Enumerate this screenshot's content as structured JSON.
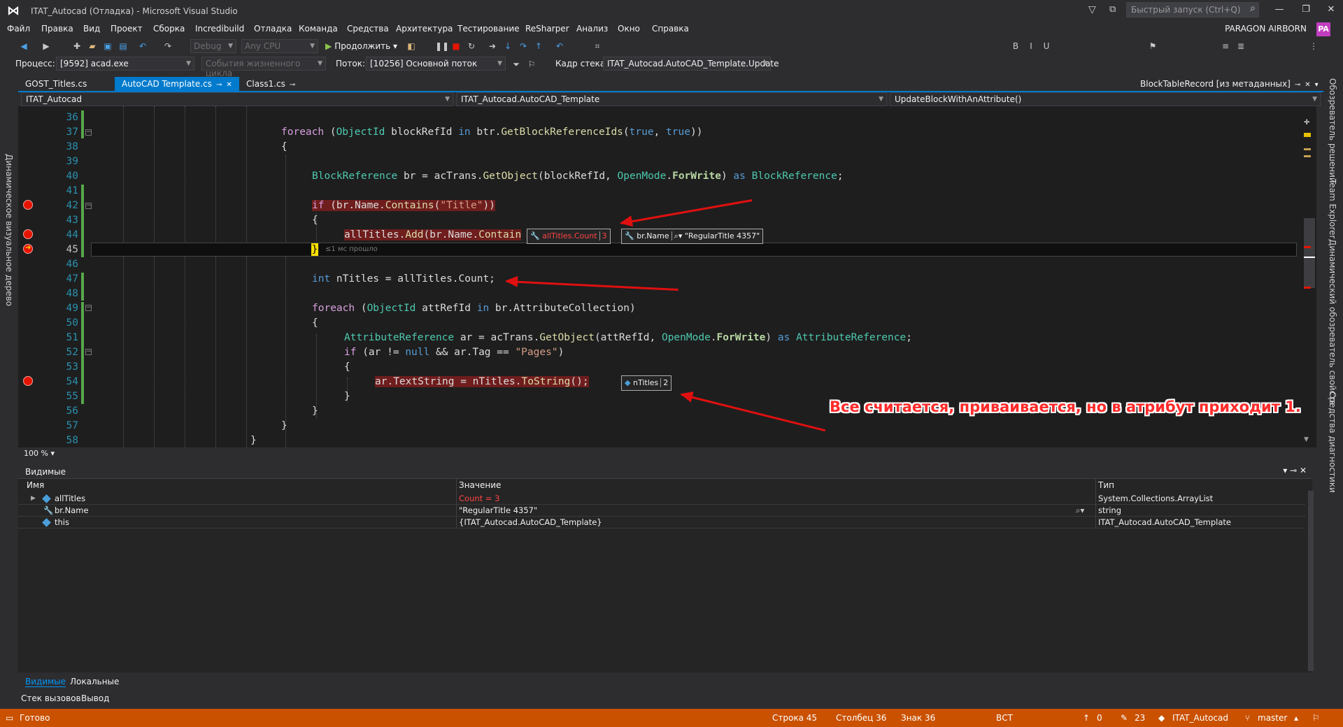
{
  "window": {
    "title": "ITAT_Autocad (Отладка) - Microsoft Visual Studio",
    "quick_launch_placeholder": "Быстрый запуск (Ctrl+Q)",
    "user": "PARAGON AIRBORN",
    "user_initials": "PA"
  },
  "menu": [
    "Файл",
    "Правка",
    "Вид",
    "Проект",
    "Сборка",
    "Incredibuild",
    "Отладка",
    "Команда",
    "Средства",
    "Архитектура",
    "Тестирование",
    "ReSharper",
    "Анализ",
    "Окно",
    "Справка"
  ],
  "toolbar": {
    "config": "Debug",
    "platform": "Any CPU",
    "continue_label": "Продолжить"
  },
  "debug_toolbar": {
    "process_label": "Процесс:",
    "process_value": "[9592] acad.exe",
    "lifecycle_label": "События жизненного цикла",
    "thread_label": "Поток:",
    "thread_value": "[10256] Основной поток",
    "stackframe_label": "Кадр стека:",
    "stackframe_value": "ITAT_Autocad.AutoCAD_Template.Update"
  },
  "left_tool": "Динамическое визуальное дерево",
  "right_tools": [
    "Обозреватель решений",
    "Team Explorer",
    "Динамический обозреватель свойств",
    "Средства диагностики"
  ],
  "tabs": [
    {
      "label": "GOST_Titles.cs",
      "active": false
    },
    {
      "label": "AutoCAD Template.cs",
      "active": true
    },
    {
      "label": "Class1.cs",
      "active": false
    }
  ],
  "right_tab": "BlockTableRecord [из метаданных]",
  "nav": {
    "project": "ITAT_Autocad",
    "class": "ITAT_Autocad.AutoCAD_Template",
    "member": "UpdateBlockWithAnAttribute()"
  },
  "code_lines": [
    {
      "n": "36"
    },
    {
      "n": "37"
    },
    {
      "n": "38"
    },
    {
      "n": "39"
    },
    {
      "n": "40"
    },
    {
      "n": "41"
    },
    {
      "n": "42"
    },
    {
      "n": "43"
    },
    {
      "n": "44"
    },
    {
      "n": "45"
    },
    {
      "n": "46"
    },
    {
      "n": "47"
    },
    {
      "n": "48"
    },
    {
      "n": "49"
    },
    {
      "n": "50"
    },
    {
      "n": "51"
    },
    {
      "n": "52"
    },
    {
      "n": "53"
    },
    {
      "n": "54"
    },
    {
      "n": "55"
    },
    {
      "n": "56"
    },
    {
      "n": "57"
    },
    {
      "n": "58"
    }
  ],
  "elapsed": "≤1 мс прошло",
  "tips": {
    "t1_name": "allTitles.Count",
    "t1_value": "3",
    "t2_name": "br.Name",
    "t2_value": "\"RegularTitle 4357\"",
    "t3_name": "nTitles",
    "t3_value": "2"
  },
  "annotation": "Все считается, приваивается, но в атрибут приходит 1.",
  "zoom": "100 %",
  "watch": {
    "title": "Видимые",
    "col_name": "Имя",
    "col_value": "Значение",
    "col_type": "Тип",
    "rows": [
      {
        "name": "allTitles",
        "value": "Count = 3",
        "type": "System.Collections.ArrayList"
      },
      {
        "name": "br.Name",
        "value": "\"RegularTitle 4357\"",
        "type": "string"
      },
      {
        "name": "this",
        "value": "{ITAT_Autocad.AutoCAD_Template}",
        "type": "ITAT_Autocad.AutoCAD_Template"
      }
    ],
    "tabs": [
      "Видимые",
      "Локальные"
    ]
  },
  "bottom_tabs": [
    "Стек вызовов",
    "Вывод"
  ],
  "status": {
    "ready": "Готово",
    "row": "Строка 45",
    "col": "Столбец 36",
    "char": "Знак 36",
    "mode": "ВСТ",
    "up": "0",
    "edits": "23",
    "repo": "ITAT_Autocad",
    "branch": "master"
  }
}
